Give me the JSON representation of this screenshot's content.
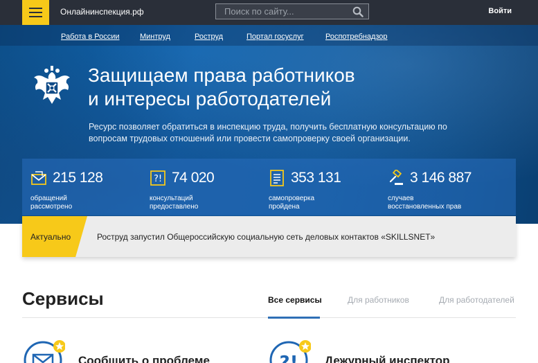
{
  "header": {
    "site_name": "Онлайнинспекция.рф",
    "search_placeholder": "Поиск по сайту...",
    "login_label": "Войти"
  },
  "subnav": [
    "Работа в России",
    "Минтруд",
    "Роструд",
    "Портал госуслуг",
    "Роспотребнадзор"
  ],
  "hero": {
    "title_line1": "Защищаем права работников",
    "title_line2": "и интересы работодателей",
    "description": "Ресурс позволяет обратиться в инспекцию труда, получить бесплатную консультацию по вопросам трудовых отношений или провести самопроверку своей организации."
  },
  "stats": [
    {
      "icon": "envelope-icon",
      "number": "215 128",
      "label_line1": "обращений",
      "label_line2": "рассмотрено"
    },
    {
      "icon": "question-icon",
      "number": "74 020",
      "label_line1": "консультаций",
      "label_line2": "предоставлено"
    },
    {
      "icon": "checklist-icon",
      "number": "353 131",
      "label_line1": "самопроверка",
      "label_line2": "пройдена"
    },
    {
      "icon": "gavel-icon",
      "number": "3 146 887",
      "label_line1": "случаев",
      "label_line2": "восстановленных прав"
    }
  ],
  "ticker": {
    "tag": "Актуально",
    "text": "Роструд запустил Общероссийскую социальную сеть деловых контактов «SKILLSNET»"
  },
  "services": {
    "title": "Сервисы",
    "tabs": [
      "Все сервисы",
      "Для работников",
      "Для работодателей"
    ],
    "active_tab": 0,
    "cards": [
      {
        "icon": "envelope-star-icon",
        "title": "Сообщить о проблеме"
      },
      {
        "icon": "question-star-icon",
        "title": "Дежурный инспектор"
      }
    ]
  },
  "colors": {
    "accent_yellow": "#f7c919",
    "topbar": "#2a2f39",
    "hero_blue": "#1264ae",
    "tab_underline": "#2f6fb6"
  }
}
